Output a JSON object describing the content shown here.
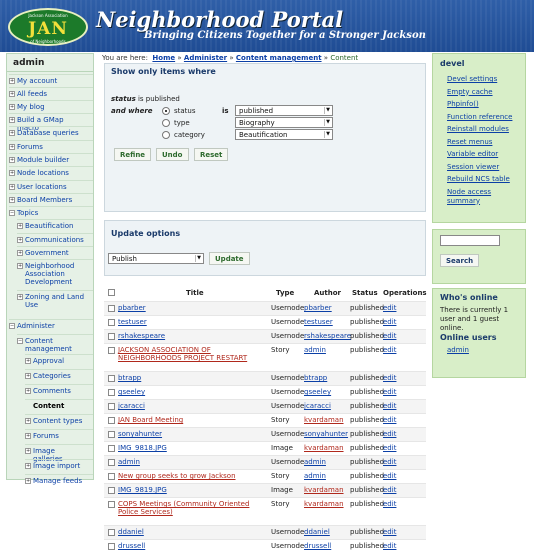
{
  "header": {
    "logo_top": "Jackson Association",
    "logo_text": "JAN",
    "logo_bottom": "of Neighborhoods",
    "site_name": "Neighborhood Portal",
    "slogan": "Bringing Citizens Together for a Stronger Jackson"
  },
  "sidebar": {
    "title": "admin",
    "items": [
      {
        "label": "My account",
        "mark": "+"
      },
      {
        "label": "All feeds",
        "mark": "+"
      },
      {
        "label": "My blog",
        "mark": "+"
      },
      {
        "label": "Build a GMap macro",
        "mark": "+"
      },
      {
        "label": "Database queries",
        "mark": "+"
      },
      {
        "label": "Forums",
        "mark": "+"
      },
      {
        "label": "Module builder",
        "mark": "+"
      },
      {
        "label": "Node locations",
        "mark": "+"
      },
      {
        "label": "User locations",
        "mark": "+"
      },
      {
        "label": "Board Members",
        "mark": "+"
      },
      {
        "label": "Topics",
        "mark": "−"
      },
      {
        "label": "Beautification",
        "mark": "+"
      },
      {
        "label": "Communications",
        "mark": "+"
      },
      {
        "label": "Government",
        "mark": "+"
      },
      {
        "label": "Neighborhood Association Development",
        "mark": "+"
      },
      {
        "label": "Zoning and Land Use",
        "mark": "+"
      },
      {
        "label": "Administer",
        "mark": "−"
      },
      {
        "label": "Content management",
        "mark": "−"
      },
      {
        "label": "Approval",
        "mark": "+"
      },
      {
        "label": "Categories",
        "mark": "+"
      },
      {
        "label": "Comments",
        "mark": "+"
      },
      {
        "label": "Content",
        "mark": ""
      },
      {
        "label": "Content types",
        "mark": "+"
      },
      {
        "label": "Forums",
        "mark": "+"
      },
      {
        "label": "Image galleries",
        "mark": "+"
      },
      {
        "label": "Image import",
        "mark": "+"
      },
      {
        "label": "Manage feeds",
        "mark": "+"
      }
    ]
  },
  "breadcrumb": {
    "prefix": "You are here:",
    "home": "Home",
    "administer": "Administer",
    "content_management": "Content management",
    "current": "Content",
    "sep": "»"
  },
  "filter": {
    "title": "Show only items where",
    "cond_1_label": "status",
    "cond_1_text": "is published",
    "and_where": "and where",
    "opt_status": "status",
    "opt_type": "type",
    "opt_category": "category",
    "is": "is",
    "status_value": "published",
    "type_value": "Biography",
    "category_value": "Beautification",
    "refine": "Refine",
    "undo": "Undo",
    "reset": "Reset"
  },
  "update": {
    "title": "Update options",
    "action_value": "Publish",
    "button": "Update"
  },
  "table": {
    "headers": [
      "Title",
      "Type",
      "Author",
      "Status",
      "Operations"
    ],
    "rows": [
      {
        "title": "pbarber",
        "type": "Usernode",
        "author": "pbarber",
        "status": "published",
        "op": "edit"
      },
      {
        "title": "testuser",
        "type": "Usernode",
        "author": "testuser",
        "status": "published",
        "op": "edit"
      },
      {
        "title": "rshakespeare",
        "type": "Usernode",
        "author": "rshakespeare",
        "status": "published",
        "op": "edit"
      },
      {
        "title": "JACKSON ASSOCIATION OF NEIGHBORHOODS PROJECT RESTART",
        "type": "Story",
        "author": "admin",
        "status": "published",
        "op": "edit"
      },
      {
        "title": "btrapp",
        "type": "Usernode",
        "author": "btrapp",
        "status": "published",
        "op": "edit"
      },
      {
        "title": "gseeley",
        "type": "Usernode",
        "author": "gseeley",
        "status": "published",
        "op": "edit"
      },
      {
        "title": "jcaracci",
        "type": "Usernode",
        "author": "jcaracci",
        "status": "published",
        "op": "edit"
      },
      {
        "title": "JAN Board Meeting",
        "type": "Story",
        "author": "kvardaman",
        "status": "published",
        "op": "edit"
      },
      {
        "title": "sonyahunter",
        "type": "Usernode",
        "author": "sonyahunter",
        "status": "published",
        "op": "edit"
      },
      {
        "title": "IMG_9818.JPG",
        "type": "Image",
        "author": "kvardaman",
        "status": "published",
        "op": "edit"
      },
      {
        "title": "admin",
        "type": "Usernode",
        "author": "admin",
        "status": "published",
        "op": "edit"
      },
      {
        "title": "New group seeks to grow Jackson",
        "type": "Story",
        "author": "admin",
        "status": "published",
        "op": "edit"
      },
      {
        "title": "IMG_9819.JPG",
        "type": "Image",
        "author": "kvardaman",
        "status": "published",
        "op": "edit"
      },
      {
        "title": "COPS Meetings (Community Oriented Police Services)",
        "type": "Story",
        "author": "kvardaman",
        "status": "published",
        "op": "edit"
      },
      {
        "title": "ddaniel",
        "type": "Usernode",
        "author": "ddaniel",
        "status": "published",
        "op": "edit"
      },
      {
        "title": "drussell",
        "type": "Usernode",
        "author": "drussell",
        "status": "published",
        "op": "edit"
      }
    ]
  },
  "devel": {
    "title": "devel",
    "links": [
      "Devel settings",
      "Empty cache",
      "Phpinfo()",
      "Function reference",
      "Reinstall modules",
      "Reset menus",
      "Variable editor",
      "Session viewer",
      "Rebuild NCS table",
      "Node access summary"
    ]
  },
  "search": {
    "value": "",
    "button": "Search"
  },
  "whos_online": {
    "title": "Who's online",
    "text": "There is currently 1 user and 1 guest online.",
    "users_title": "Online users",
    "user": "admin"
  }
}
